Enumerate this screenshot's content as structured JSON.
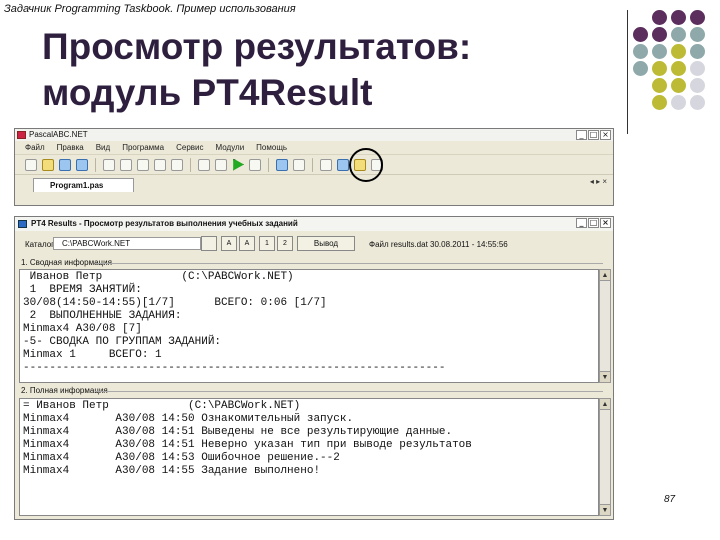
{
  "slide": {
    "course": "Задачник Programming Taskbook. Пример использования",
    "title_line1": "Просмотр результатов:",
    "title_line2": "модуль PT4Result",
    "page_number": "87",
    "accent_colors": [
      "#5b2e5e",
      "#8fa9ab",
      "#bdbb36",
      "#d6d6de"
    ]
  },
  "ide": {
    "title": "PascalABC.NET",
    "menu": [
      "Файл",
      "Правка",
      "Вид",
      "Программа",
      "Сервис",
      "Модули",
      "Помощь"
    ],
    "window_buttons": [
      "_",
      "□",
      "×"
    ],
    "tab": "Program1.pas",
    "tab_controls": "◂ ▸ ×"
  },
  "pt4": {
    "title": "PT4 Results - Просмотр результатов выполнения учебных заданий",
    "catalog_label": "Каталог",
    "catalog_path": "C:\\PABCWork.NET",
    "buttons": [
      "A",
      "A",
      "1",
      "2"
    ],
    "show_button": "Вывод",
    "file_info": "Файл results.dat 30.08.2011 - 14:55:56",
    "section1_title": "1. Сводная информация",
    "section1_text": " Иванов Петр            (C:\\PABCWork.NET)\n 1  ВРЕМЯ ЗАНЯТИЙ:\n30/08(14:50-14:55)[1/7]      ВСЕГО: 0:06 [1/7]\n 2  ВЫПОЛНЕННЫЕ ЗАДАНИЯ:\nMinmax4 A30/08 [7]\n-5- СВОДКА ПО ГРУППАМ ЗАДАНИЙ:\nMinmax 1     ВСЕГО: 1\n----------------------------------------------------------------",
    "section2_title": "2. Полная информация",
    "section2_text": "= Иванов Петр            (C:\\PABCWork.NET)\nMinmax4       A30/08 14:50 Ознакомительный запуск.\nMinmax4       A30/08 14:51 Выведены не все результирующие данные.\nMinmax4       A30/08 14:51 Неверно указан тип при выводе результатов\nMinmax4       A30/08 14:53 Ошибочное решение.--2\nMinmax4       A30/08 14:55 Задание выполнено!"
  }
}
